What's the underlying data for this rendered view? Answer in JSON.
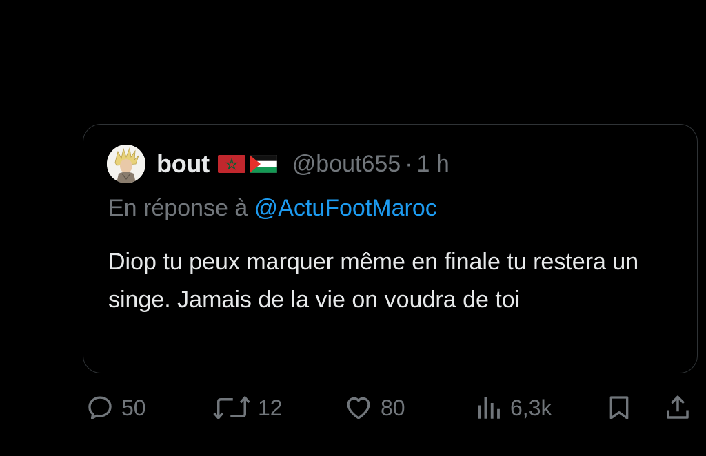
{
  "tweet": {
    "author": {
      "display_name": "bout",
      "handle": "@bout655",
      "flags": [
        "morocco-flag",
        "palestine-flag"
      ],
      "avatar_icon": "anime-character-avatar"
    },
    "separator": "·",
    "time": "1 h",
    "reply_prefix": "En réponse à ",
    "reply_to": "@ActuFootMaroc",
    "text": "Diop tu peux marquer même en finale tu restera un singe. Jamais de la vie on voudra de toi"
  },
  "actions": {
    "replies": "50",
    "reposts": "12",
    "likes": "80",
    "views": "6,3k"
  },
  "colors": {
    "background": "#000000",
    "text_primary": "#e7e9ea",
    "text_secondary": "#71767b",
    "link": "#1d9bf0",
    "border": "#2f3336"
  }
}
